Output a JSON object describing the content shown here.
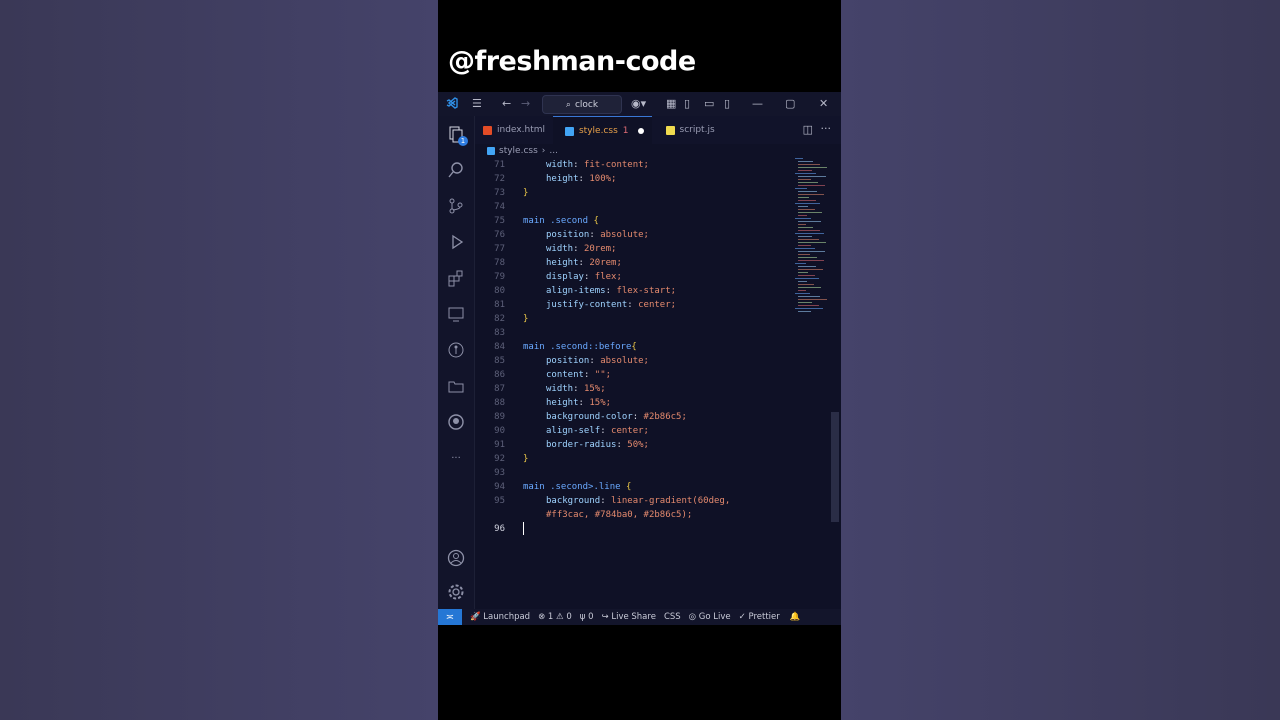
{
  "handle": "@freshman-code",
  "titlebar": {
    "search_text": "clock"
  },
  "tabs": [
    {
      "label": "index.html",
      "icon": "html-file-icon",
      "color": "#e34c26"
    },
    {
      "label": "style.css",
      "icon": "css-file-icon",
      "color": "#42a5f5",
      "problems": "1",
      "modified": true
    },
    {
      "label": "script.js",
      "icon": "js-file-icon",
      "color": "#f0db4f"
    }
  ],
  "breadcrumb": {
    "file": "style.css",
    "rest": "..."
  },
  "code_lines": [
    {
      "n": "71",
      "text": "width: fit-content;"
    },
    {
      "n": "72",
      "text": "height: 100%;"
    },
    {
      "n": "73",
      "text": "}"
    },
    {
      "n": "74",
      "text": ""
    },
    {
      "n": "75",
      "text": "main .second {"
    },
    {
      "n": "76",
      "text": "position: absolute;"
    },
    {
      "n": "77",
      "text": "width: 20rem;"
    },
    {
      "n": "78",
      "text": "height: 20rem;"
    },
    {
      "n": "79",
      "text": "display: flex;"
    },
    {
      "n": "80",
      "text": "align-items: flex-start;"
    },
    {
      "n": "81",
      "text": "justify-content: center;"
    },
    {
      "n": "82",
      "text": "}"
    },
    {
      "n": "83",
      "text": ""
    },
    {
      "n": "84",
      "text": "main .second::before{"
    },
    {
      "n": "85",
      "text": "position: absolute;"
    },
    {
      "n": "86",
      "text": "content: \"\";"
    },
    {
      "n": "87",
      "text": "width: 15%;"
    },
    {
      "n": "88",
      "text": "height: 15%;"
    },
    {
      "n": "89",
      "text": "background-color: #2b86c5;"
    },
    {
      "n": "90",
      "text": "align-self: center;"
    },
    {
      "n": "91",
      "text": "border-radius: 50%;"
    },
    {
      "n": "92",
      "text": "}"
    },
    {
      "n": "93",
      "text": ""
    },
    {
      "n": "94",
      "text": "main .second>.line {"
    },
    {
      "n": "95",
      "text": "background: linear-gradient(60deg,"
    },
    {
      "n": "",
      "text": "#ff3cac, #784ba0, #2b86c5);"
    },
    {
      "n": "96",
      "text": ""
    }
  ],
  "status": {
    "launchpad": "Launchpad",
    "errors": "1",
    "warnings": "0",
    "ports": "0",
    "live_share": "Live Share",
    "language": "CSS",
    "go_live": "Go Live",
    "prettier": "Prettier"
  }
}
